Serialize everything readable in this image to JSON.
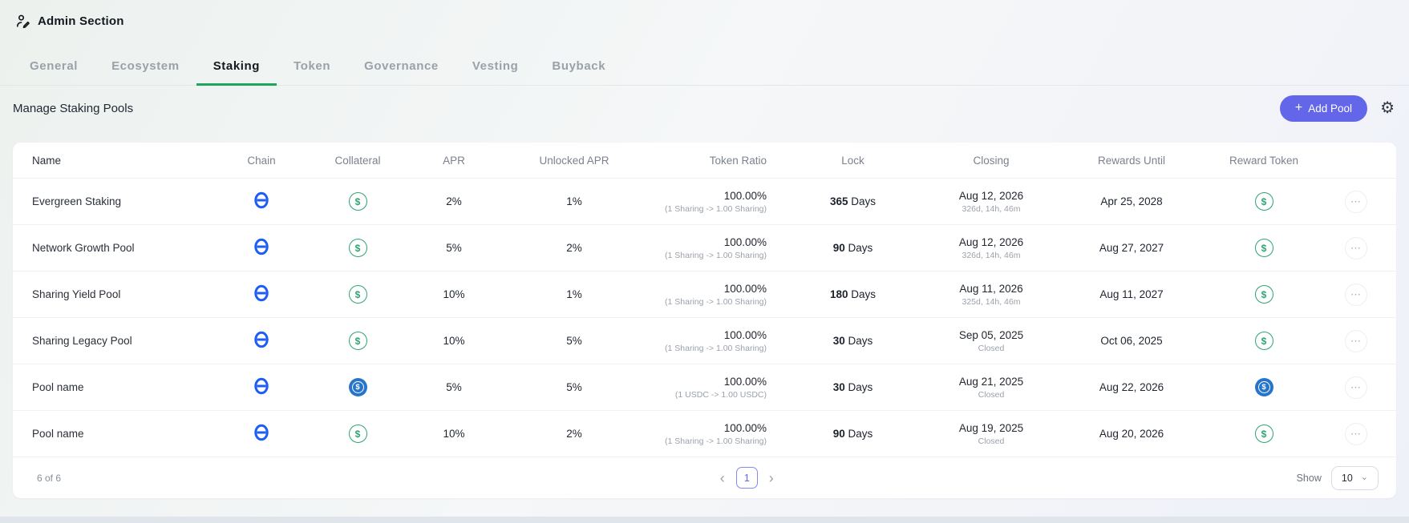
{
  "app": {
    "title": "Admin Section"
  },
  "tabs": [
    {
      "label": "General"
    },
    {
      "label": "Ecosystem"
    },
    {
      "label": "Staking"
    },
    {
      "label": "Token"
    },
    {
      "label": "Governance"
    },
    {
      "label": "Vesting"
    },
    {
      "label": "Buyback"
    }
  ],
  "active_tab": "Staking",
  "toolbar": {
    "heading": "Manage Staking Pools",
    "plus": "+",
    "add_pool_label": "Add Pool",
    "gear_icon": "gear"
  },
  "table": {
    "columns": {
      "name": "Name",
      "chain": "Chain",
      "collateral": "Collateral",
      "apr": "APR",
      "unlocked_apr": "Unlocked APR",
      "token_ratio": "Token Ratio",
      "lock": "Lock",
      "closing": "Closing",
      "rewards_until": "Rewards Until",
      "reward_token": "Reward Token"
    },
    "coin_symbol": "$",
    "dots": "⋯",
    "rows": [
      {
        "name": "Evergreen Staking",
        "chain_icon": "chain-token",
        "collateral_icon": "sharing-coin",
        "apr": "2%",
        "unlocked_apr": "1%",
        "ratio": "100.00%",
        "ratio_detail": "(1 Sharing -> 1.00 Sharing)",
        "lock_value": "365",
        "lock_unit": "Days",
        "closing_date": "Aug 12, 2026",
        "closing_status": "326d, 14h, 46m",
        "rewards_until": "Apr 25, 2028",
        "reward_icon": "sharing-coin"
      },
      {
        "name": "Network Growth Pool",
        "chain_icon": "chain-token",
        "collateral_icon": "sharing-coin",
        "apr": "5%",
        "unlocked_apr": "2%",
        "ratio": "100.00%",
        "ratio_detail": "(1 Sharing -> 1.00 Sharing)",
        "lock_value": "90",
        "lock_unit": "Days",
        "closing_date": "Aug 12, 2026",
        "closing_status": "326d, 14h, 46m",
        "rewards_until": "Aug 27, 2027",
        "reward_icon": "sharing-coin"
      },
      {
        "name": "Sharing Yield Pool",
        "chain_icon": "chain-token",
        "collateral_icon": "sharing-coin",
        "apr": "10%",
        "unlocked_apr": "1%",
        "ratio": "100.00%",
        "ratio_detail": "(1 Sharing -> 1.00 Sharing)",
        "lock_value": "180",
        "lock_unit": "Days",
        "closing_date": "Aug 11, 2026",
        "closing_status": "325d, 14h, 46m",
        "rewards_until": "Aug 11, 2027",
        "reward_icon": "sharing-coin"
      },
      {
        "name": "Sharing Legacy Pool",
        "chain_icon": "chain-token",
        "collateral_icon": "sharing-coin",
        "apr": "10%",
        "unlocked_apr": "5%",
        "ratio": "100.00%",
        "ratio_detail": "(1 Sharing -> 1.00 Sharing)",
        "lock_value": "30",
        "lock_unit": "Days",
        "closing_date": "Sep 05, 2025",
        "closing_status": "Closed",
        "rewards_until": "Oct 06, 2025",
        "reward_icon": "sharing-coin"
      },
      {
        "name": "Pool name",
        "chain_icon": "chain-token",
        "collateral_icon": "usdc-coin",
        "apr": "5%",
        "unlocked_apr": "5%",
        "ratio": "100.00%",
        "ratio_detail": "(1 USDC -> 1.00 USDC)",
        "lock_value": "30",
        "lock_unit": "Days",
        "closing_date": "Aug 21, 2025",
        "closing_status": "Closed",
        "rewards_until": "Aug 22, 2026",
        "reward_icon": "usdc-coin"
      },
      {
        "name": "Pool name",
        "chain_icon": "chain-token",
        "collateral_icon": "sharing-coin",
        "apr": "10%",
        "unlocked_apr": "2%",
        "ratio": "100.00%",
        "ratio_detail": "(1 Sharing -> 1.00 Sharing)",
        "lock_value": "90",
        "lock_unit": "Days",
        "closing_date": "Aug 19, 2025",
        "closing_status": "Closed",
        "rewards_until": "Aug 20, 2026",
        "reward_icon": "sharing-coin"
      }
    ]
  },
  "footer": {
    "count": "6 of 6",
    "prev": "‹",
    "page": "1",
    "next": "›",
    "show_label": "Show",
    "page_size": "10",
    "caret": "⌄"
  },
  "colors": {
    "accent_purple": "#6466e9",
    "tab_green": "#1ea65b",
    "chain_blue": "#1d5cf5",
    "coin_green": "#2fa472",
    "usdc_blue": "#2775ca"
  }
}
